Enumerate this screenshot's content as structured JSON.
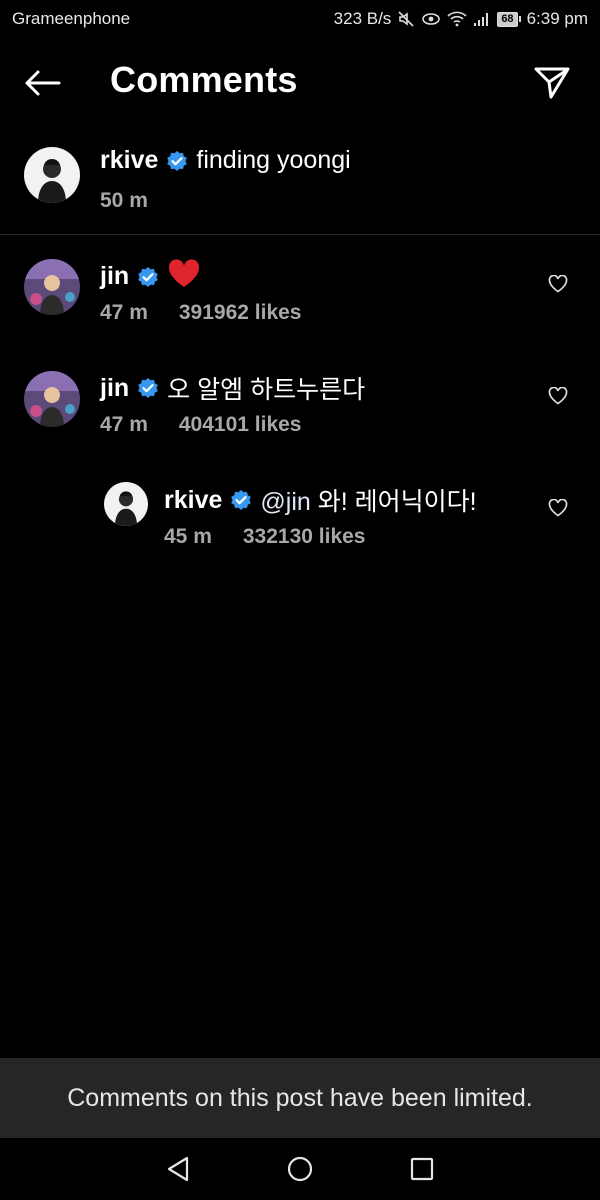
{
  "status_bar": {
    "carrier": "Grameenphone",
    "network_speed": "323 B/s",
    "battery_level": "68",
    "time": "6:39 pm",
    "icons": [
      "mute-icon",
      "eye-icon",
      "wifi-icon",
      "signal-icon",
      "battery-icon"
    ]
  },
  "header": {
    "title": "Comments",
    "back_icon": "arrow-left-icon",
    "share_icon": "paper-plane-icon"
  },
  "caption": {
    "username": "rkive",
    "verified": true,
    "text": "finding yoongi",
    "time": "50 m"
  },
  "comments": [
    {
      "username": "jin",
      "verified": true,
      "text": "❤️",
      "time": "47 m",
      "likes": "391962 likes"
    },
    {
      "username": "jin",
      "verified": true,
      "text": "오 알엠 하트누른다",
      "time": "47 m",
      "likes": "404101 likes"
    }
  ],
  "reply": {
    "username": "rkive",
    "verified": true,
    "mention": "@jin",
    "text": " 와! 레어닉이다!",
    "time": "45 m",
    "likes": "332130 likes"
  },
  "banner": {
    "text": "Comments on this post have been limited."
  },
  "nav": {
    "icons": [
      "back-triangle-icon",
      "home-circle-icon",
      "recents-square-icon"
    ]
  },
  "colors": {
    "background": "#000000",
    "verified_badge": "#3897f0",
    "secondary_text": "#a8a8a8",
    "banner_bg": "#262626",
    "heart": "#e0242e"
  }
}
